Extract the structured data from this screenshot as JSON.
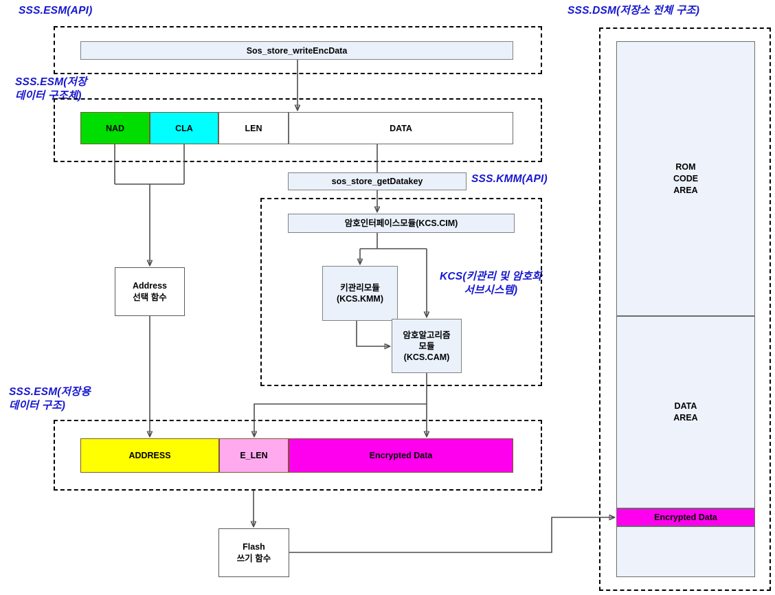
{
  "diagram": {
    "title_labels": {
      "esm_api": "SSS.ESM(API)",
      "esm_struct": "SSS.ESM(저장\n데이터 구조체)",
      "kmm_api": "SSS.KMM(API)",
      "kcs": "KCS(키관리 및 암호화\n서브시스템)",
      "esm_store": "SSS.ESM(저장용\n데이터 구조)",
      "dsm": "SSS.DSM(저장소 전체 구조)"
    },
    "boxes": {
      "write_enc_data": "Sos_store_writeEncData",
      "get_datakey": "sos_store_getDatakey",
      "cim": "암호인터페이스모듈(KCS.CIM)",
      "kmm": "키관리모듈\n(KCS.KMM)",
      "cam": "암호알고리즘\n모듈\n(KCS.CAM)",
      "address_func": "Address\n선택 함수",
      "flash_func": "Flash\n쓰기 함수"
    },
    "struct_in": {
      "fields": [
        {
          "name": "NAD",
          "color": "#00dd00"
        },
        {
          "name": "CLA",
          "color": "#00ffff"
        },
        {
          "name": "LEN",
          "color": "#ffffff"
        },
        {
          "name": "DATA",
          "color": "#ffffff"
        }
      ]
    },
    "struct_out": {
      "fields": [
        {
          "name": "ADDRESS",
          "color": "#ffff00"
        },
        {
          "name": "E_LEN",
          "color": "#ffaaee"
        },
        {
          "name": "Encrypted Data",
          "color": "#ff00ee"
        }
      ]
    },
    "memory": {
      "rom": "ROM\nCODE\nAREA",
      "data": "DATA\nAREA",
      "encrypted": "Encrypted Data",
      "encrypted_color": "#ff00ee"
    },
    "colors": {
      "label_blue": "#1616d8",
      "box_fill": "#eaf1fb",
      "memory_fill": "#edf2fb",
      "wire": "#4d4d4d"
    }
  }
}
